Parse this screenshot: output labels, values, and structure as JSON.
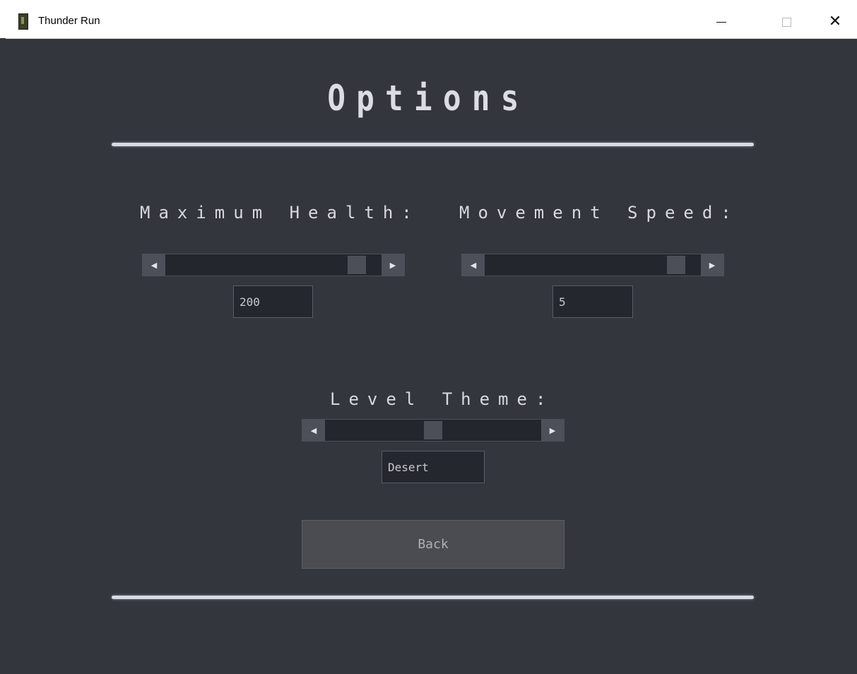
{
  "window": {
    "title": "Thunder Run",
    "icon": "app-icon",
    "controls": {
      "minimize": "minimize-icon",
      "maximize": "maximize-icon",
      "close": "close-icon"
    }
  },
  "page": {
    "heading": "Options"
  },
  "settings": {
    "max_health": {
      "label": "Maximum Health:",
      "value": "200",
      "slider_fraction": 0.92
    },
    "move_speed": {
      "label": "Movement Speed:",
      "value": "5",
      "slider_fraction": 0.92
    },
    "level_theme": {
      "label": "Level Theme:",
      "value": "Desert",
      "slider_fraction": 0.5
    }
  },
  "buttons": {
    "back": "Back"
  },
  "colors": {
    "background": "#34363e",
    "text": "#dcdde4",
    "field_bg": "#24272e",
    "button_bg": "#4a4c52"
  }
}
